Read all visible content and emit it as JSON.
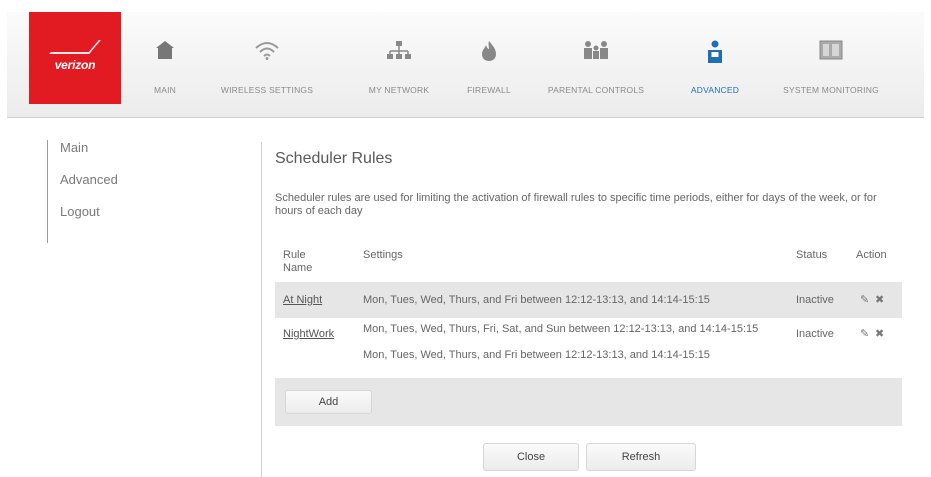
{
  "brand": {
    "logo_text": "verizon",
    "accent": "#e21b23",
    "active_color": "#1f6fb5"
  },
  "nav": [
    {
      "label": "MAIN",
      "icon": "house-icon"
    },
    {
      "label": "WIRELESS SETTINGS",
      "icon": "wifi-icon"
    },
    {
      "label": "MY NETWORK",
      "icon": "network-icon"
    },
    {
      "label": "FIREWALL",
      "icon": "flame-icon"
    },
    {
      "label": "PARENTAL CONTROLS",
      "icon": "family-icon"
    },
    {
      "label": "ADVANCED",
      "icon": "advanced-user-icon",
      "active": true
    },
    {
      "label": "SYSTEM MONITORING",
      "icon": "monitor-icon"
    }
  ],
  "sidebar": {
    "items": [
      {
        "label": "Main"
      },
      {
        "label": "Advanced"
      },
      {
        "label": "Logout"
      }
    ]
  },
  "main": {
    "title": "Scheduler Rules",
    "description": "Scheduler rules are used for limiting the activation of firewall rules to specific time periods, either for days of the week, or for hours of each day",
    "table": {
      "headers": {
        "rule_name": "Rule Name",
        "settings": "Settings",
        "status": "Status",
        "action": "Action"
      },
      "rows": [
        {
          "name": "At Night",
          "settings": "Mon, Tues, Wed, Thurs, and Fri between 12:12-13:13, and 14:14-15:15",
          "settings_2": "",
          "status": "Inactive"
        },
        {
          "name": "NightWork",
          "settings": "Mon, Tues, Wed, Thurs, Fri, Sat, and Sun between 12:12-13:13, and 14:14-15:15",
          "settings_2": "Mon, Tues, Wed, Thurs, and Fri between 12:12-13:13, and 14:14-15:15",
          "status": "Inactive"
        }
      ],
      "add_label": "Add"
    },
    "buttons": {
      "close": "Close",
      "refresh": "Refresh"
    }
  }
}
